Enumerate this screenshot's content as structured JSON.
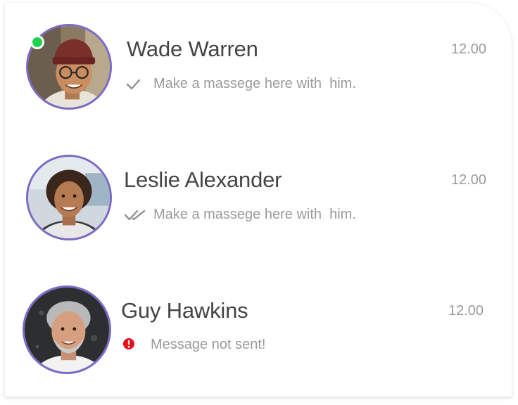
{
  "colors": {
    "avatar_border": "#7a6ac7",
    "online": "#1ed44f",
    "error": "#e8101a",
    "name_text": "#444444",
    "secondary_text": "#9a9a9a"
  },
  "conversations": [
    {
      "name": "Wade Warren",
      "time": "12.00",
      "message": "Make a massege here with  him.",
      "status_icon": "single-check-icon",
      "online": true
    },
    {
      "name": "Leslie Alexander",
      "time": "12.00",
      "message": "Make a massege here with  him.",
      "status_icon": "double-check-icon",
      "online": false
    },
    {
      "name": "Guy Hawkins",
      "time": "12.00",
      "message": "Message not sent!",
      "status_icon": "error-icon",
      "online": false
    }
  ]
}
